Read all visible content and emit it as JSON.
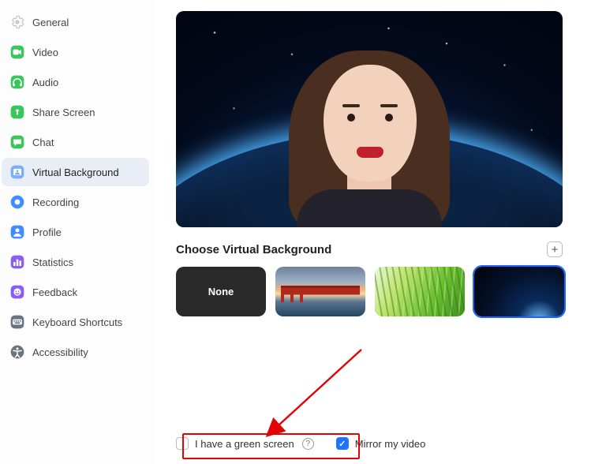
{
  "sidebar": {
    "items": [
      {
        "id": "general",
        "label": "General",
        "icon": "settings-icon",
        "color": "#c9c9c9"
      },
      {
        "id": "video",
        "label": "Video",
        "icon": "video-icon",
        "color": "#38c75c"
      },
      {
        "id": "audio",
        "label": "Audio",
        "icon": "headphones-icon",
        "color": "#38c75c"
      },
      {
        "id": "share-screen",
        "label": "Share Screen",
        "icon": "share-screen-icon",
        "color": "#38c75c"
      },
      {
        "id": "chat",
        "label": "Chat",
        "icon": "chat-icon",
        "color": "#38c75c"
      },
      {
        "id": "virtual-background",
        "label": "Virtual Background",
        "icon": "virtual-bg-icon",
        "color": "#6fa8ff",
        "active": true
      },
      {
        "id": "recording",
        "label": "Recording",
        "icon": "recording-icon",
        "color": "#3f8dff"
      },
      {
        "id": "profile",
        "label": "Profile",
        "icon": "profile-icon",
        "color": "#3f8dff"
      },
      {
        "id": "statistics",
        "label": "Statistics",
        "icon": "statistics-icon",
        "color": "#8b5cf6"
      },
      {
        "id": "feedback",
        "label": "Feedback",
        "icon": "feedback-icon",
        "color": "#8b5cf6"
      },
      {
        "id": "keyboard-shortcuts",
        "label": "Keyboard Shortcuts",
        "icon": "keyboard-icon",
        "color": "#6b7280"
      },
      {
        "id": "accessibility",
        "label": "Accessibility",
        "icon": "accessibility-icon",
        "color": "#6b7280"
      }
    ]
  },
  "main": {
    "section_title": "Choose Virtual Background",
    "add_tooltip": "Add Image",
    "thumbnails": [
      {
        "id": "none",
        "label": "None"
      },
      {
        "id": "bridge",
        "label": "Golden Gate Bridge"
      },
      {
        "id": "grass",
        "label": "Grass"
      },
      {
        "id": "space",
        "label": "Earth from Space",
        "selected": true
      }
    ],
    "checkboxes": {
      "green_screen": {
        "label": "I have a green screen",
        "checked": false
      },
      "mirror": {
        "label": "Mirror my video",
        "checked": true
      }
    }
  },
  "annotation": {
    "target": "green-screen-checkbox"
  }
}
